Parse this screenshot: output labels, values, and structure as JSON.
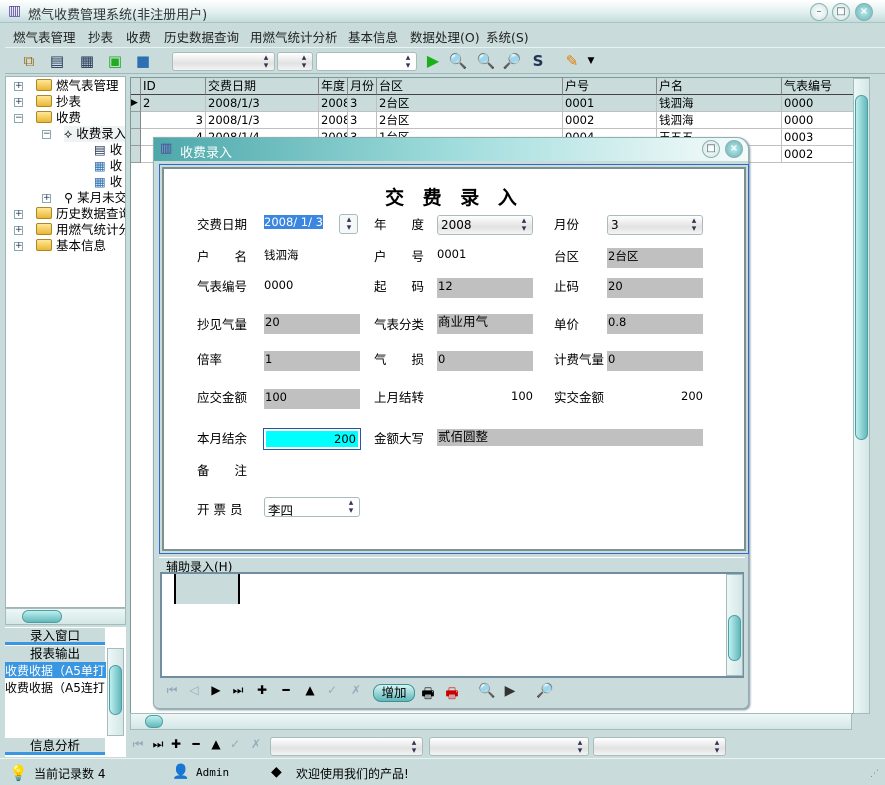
{
  "app": {
    "title": "燃气收费管理系统(非注册用户)"
  },
  "menu": [
    "燃气表管理",
    "抄表",
    "收费",
    "历史数据查询",
    "用燃气统计分析",
    "基本信息",
    "数据处理(O)",
    "系统(S)"
  ],
  "tree": {
    "items": [
      "燃气表管理",
      "抄表",
      "收费",
      "收费录入",
      "收",
      "收",
      "收",
      "某月未交",
      "历史数据查询",
      "用燃气统计分析",
      "基本信息"
    ]
  },
  "panel": {
    "tab_entry": "录入窗口",
    "tab_report": "报表输出",
    "tab_info": "信息分析",
    "report_items": [
      "收费收据（A5单打",
      "收费收据（A5连打"
    ]
  },
  "grid": {
    "columns": [
      "ID",
      "交费日期",
      "年度",
      "月份",
      "台区",
      "户号",
      "户名",
      "气表编号"
    ],
    "rows": [
      [
        "2",
        "2008/1/3",
        "2008",
        "3",
        "2台区",
        "0001",
        "钱泗海",
        "0000"
      ],
      [
        "3",
        "2008/1/3",
        "2008",
        "3",
        "2台区",
        "0002",
        "钱泗海",
        "0000"
      ],
      [
        "4",
        "2008/1/4",
        "2008",
        "3",
        "1台区",
        "0004",
        "王五五",
        "0003"
      ],
      [
        "",
        "",
        "",
        "",
        "",
        "",
        "",
        "0002"
      ]
    ]
  },
  "dialog": {
    "title": "收费录入",
    "heading": "交 费 录 入",
    "labels": {
      "date": "交费日期",
      "year": "年　　度",
      "month": "月份",
      "name": "户　　名",
      "account": "户　　号",
      "area": "台区",
      "meter": "气表编号",
      "start": "起　　码",
      "end": "止码",
      "reading": "抄见气量",
      "meter_type": "气表分类",
      "price": "单价",
      "ratio": "倍率",
      "loss": "气　　损",
      "billed": "计费气量",
      "due": "应交金额",
      "carry": "上月结转",
      "paid": "实交金额",
      "balance": "本月结余",
      "amount_words": "金额大写",
      "remark": "备　　注",
      "issuer": "开 票 员"
    },
    "values": {
      "date": "2008/ 1/ 3",
      "year": "2008",
      "month": "3",
      "name": "钱泗海",
      "account": "0001",
      "area": "2台区",
      "meter": "0000",
      "start": "12",
      "end": "20",
      "reading": "20",
      "meter_type": "商业用气",
      "price": "0.8",
      "ratio": "1",
      "loss": "0",
      "billed": "0",
      "due": "100",
      "carry": "100",
      "paid": "200",
      "balance": "200",
      "amount_words": "贰佰圆整",
      "issuer": "李四"
    },
    "aux_label": "辅助录入(H)",
    "add_button": "增加"
  },
  "status": {
    "records": "当前记录数 4",
    "user": "Admin",
    "welcome": "欢迎使用我们的产品!"
  },
  "colors": {
    "accent": "#3a96e0",
    "highlight_field": "#00ffff",
    "readonly_field": "#c0c0c0",
    "chrome": "#c9dcdb"
  }
}
